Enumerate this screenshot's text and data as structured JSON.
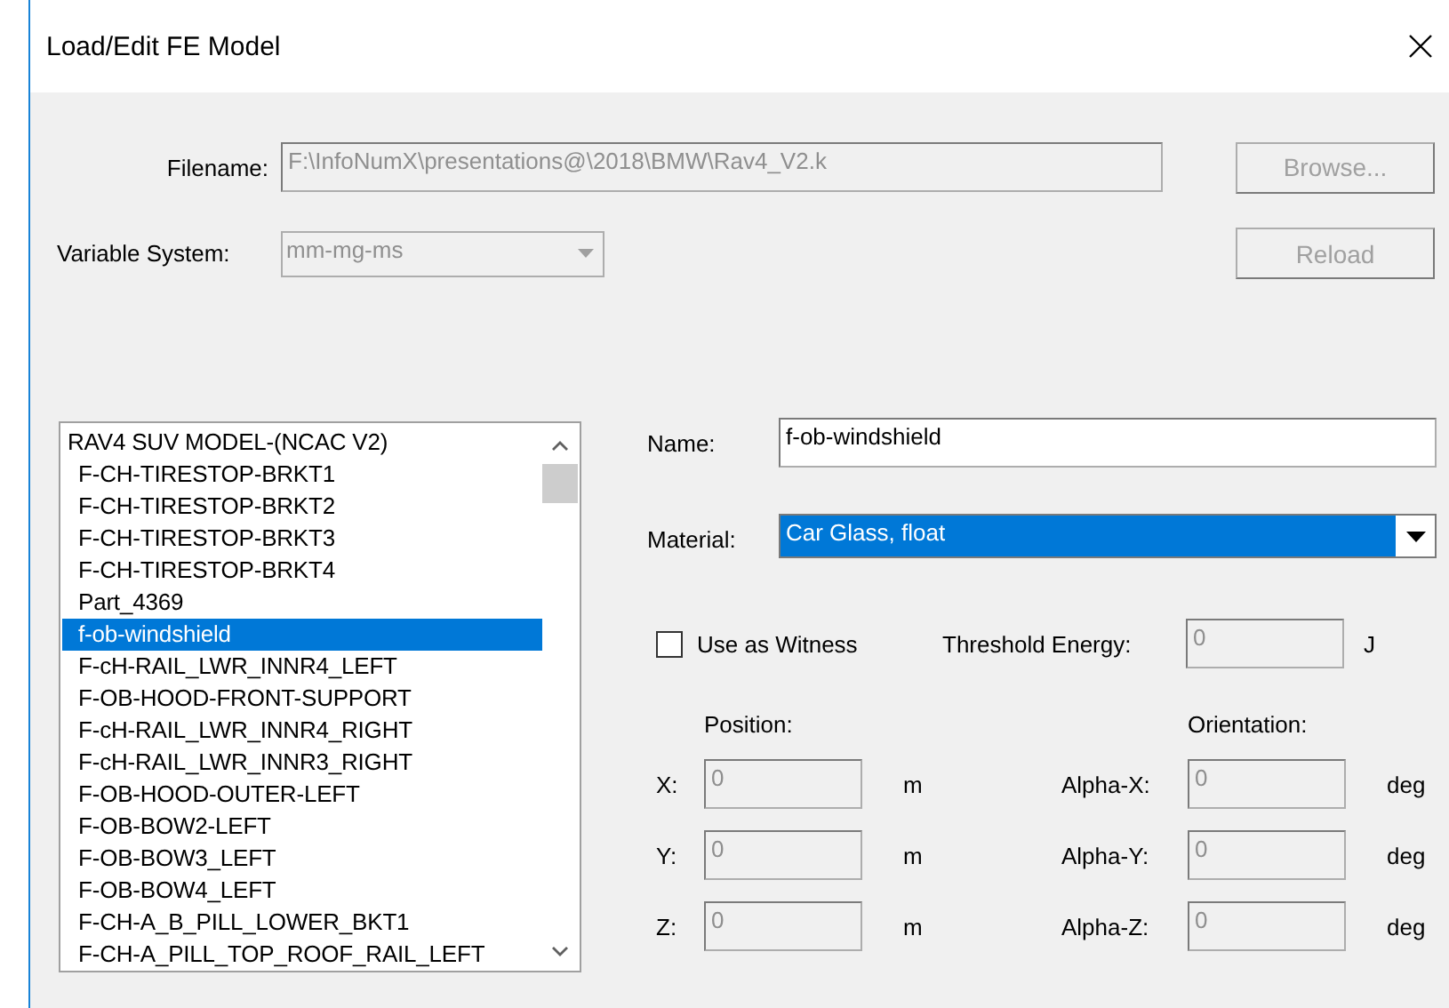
{
  "window": {
    "title": "Load/Edit FE Model"
  },
  "filename": {
    "label": "Filename:",
    "value": "F:\\InfoNumX\\presentations@\\2018\\BMW\\Rav4_V2.k",
    "disabled": true
  },
  "browse_button": {
    "label": "Browse...",
    "disabled": true
  },
  "variable_system": {
    "label": "Variable System:",
    "value": "mm-mg-ms",
    "disabled": true
  },
  "reload_button": {
    "label": "Reload",
    "disabled": true
  },
  "parts_tree": {
    "items": [
      {
        "label": "RAV4 SUV MODEL-(NCAC V2)",
        "selected": false,
        "children": [
          {
            "label": "F-CH-TIRESTOP-BRKT1",
            "selected": false
          },
          {
            "label": "F-CH-TIRESTOP-BRKT2",
            "selected": false
          },
          {
            "label": "F-CH-TIRESTOP-BRKT3",
            "selected": false
          },
          {
            "label": "F-CH-TIRESTOP-BRKT4",
            "selected": false
          },
          {
            "label": "Part_4369",
            "selected": false
          },
          {
            "label": "f-ob-windshield",
            "selected": true
          },
          {
            "label": "F-cH-RAIL_LWR_INNR4_LEFT",
            "selected": false
          },
          {
            "label": "F-OB-HOOD-FRONT-SUPPORT",
            "selected": false
          },
          {
            "label": "F-cH-RAIL_LWR_INNR4_RIGHT",
            "selected": false
          },
          {
            "label": "F-cH-RAIL_LWR_INNR3_RIGHT",
            "selected": false
          },
          {
            "label": "F-OB-HOOD-OUTER-LEFT",
            "selected": false
          },
          {
            "label": "F-OB-BOW2-LEFT",
            "selected": false
          },
          {
            "label": "F-OB-BOW3_LEFT",
            "selected": false
          },
          {
            "label": "F-OB-BOW4_LEFT",
            "selected": false
          },
          {
            "label": "F-CH-A_B_PILL_LOWER_BKT1",
            "selected": false
          },
          {
            "label": "F-CH-A_PILL_TOP_ROOF_RAIL_LEFT",
            "selected": false
          }
        ]
      }
    ]
  },
  "name": {
    "label": "Name:",
    "value": "f-ob-windshield",
    "disabled": false
  },
  "material": {
    "label": "Material:",
    "value": "Car Glass, float",
    "highlighted": true
  },
  "witness": {
    "label": "Use as Witness",
    "checked": false
  },
  "threshold": {
    "label": "Threshold Energy:",
    "value": "0",
    "unit": "J",
    "disabled": true
  },
  "position": {
    "heading": "Position:",
    "fields": [
      {
        "label": "X:",
        "value": "0",
        "unit": "m",
        "disabled": true
      },
      {
        "label": "Y:",
        "value": "0",
        "unit": "m",
        "disabled": true
      },
      {
        "label": "Z:",
        "value": "0",
        "unit": "m",
        "disabled": true
      }
    ]
  },
  "orientation": {
    "heading": "Orientation:",
    "fields": [
      {
        "label": "Alpha-X:",
        "value": "0",
        "unit": "deg",
        "disabled": true
      },
      {
        "label": "Alpha-Y:",
        "value": "0",
        "unit": "deg",
        "disabled": true
      },
      {
        "label": "Alpha-Z:",
        "value": "0",
        "unit": "deg",
        "disabled": true
      }
    ]
  }
}
